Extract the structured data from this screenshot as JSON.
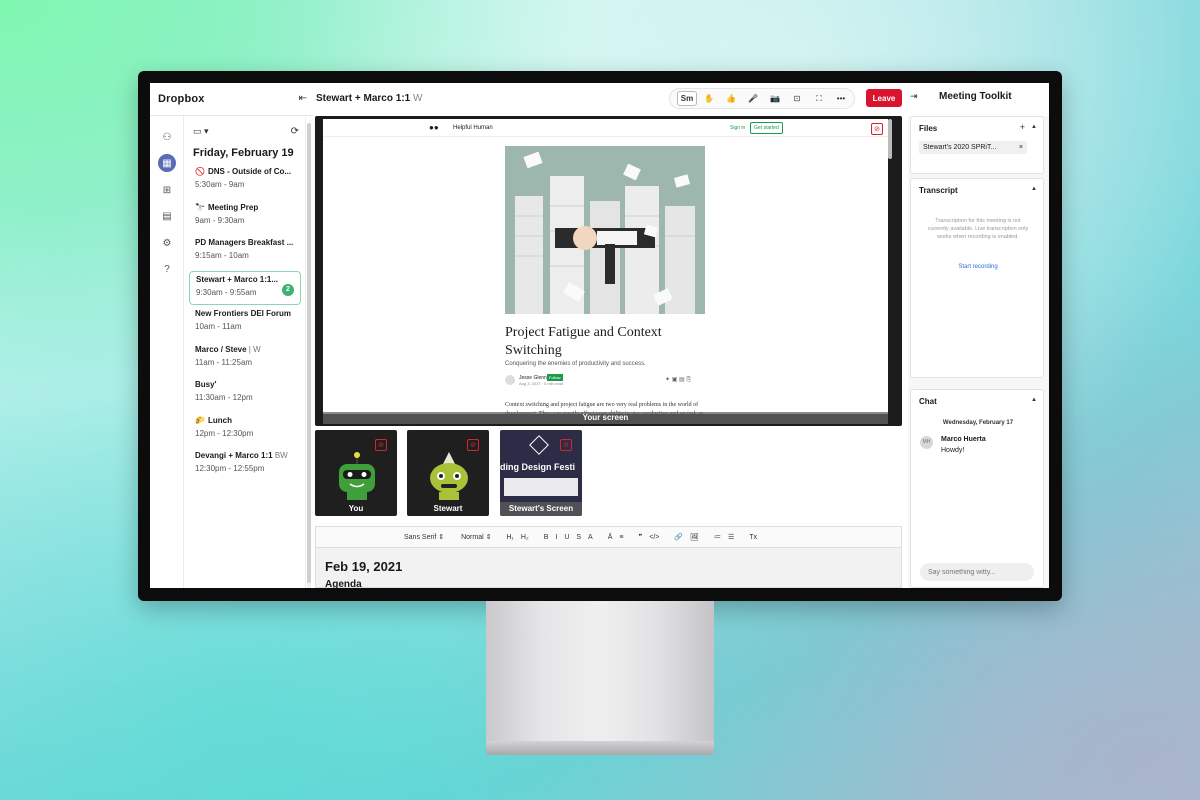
{
  "app": {
    "logo": "Dropbox",
    "collapse_icon": "collapse-left-icon"
  },
  "calendar": {
    "view_icon": "calendar-view-icon",
    "refresh_icon": "refresh-icon",
    "date_heading": "Friday, February 19",
    "events": [
      {
        "emoji": "🚫",
        "title": "DNS - Outside of Co...",
        "suffix": "",
        "time": "5:30am - 9am"
      },
      {
        "emoji": "🔭",
        "title": "Meeting Prep",
        "suffix": "",
        "time": "9am - 9:30am"
      },
      {
        "emoji": "",
        "title": "PD Managers Breakfast ...",
        "suffix": "",
        "time": "9:15am - 10am"
      },
      {
        "emoji": "",
        "title": "Stewart + Marco 1:1...",
        "suffix": "",
        "time": "9:30am - 9:55am",
        "badge": "2",
        "active": true
      },
      {
        "emoji": "",
        "title": "New Frontiers DEI Forum",
        "suffix": "",
        "time": "10am - 11am"
      },
      {
        "emoji": "",
        "title": "Marco / Steve",
        "suffix": " | W",
        "time": "11am - 11:25am"
      },
      {
        "emoji": "",
        "title": "Busy'",
        "suffix": "",
        "time": "11:30am - 12pm"
      },
      {
        "emoji": "🌮",
        "title": "Lunch",
        "suffix": "",
        "time": "12pm - 12:30pm"
      },
      {
        "emoji": "",
        "title": "Devangi + Marco 1:1",
        "suffix": " BW",
        "time": "12:30pm - 12:55pm"
      }
    ]
  },
  "meeting": {
    "title": "Stewart + Marco 1:1",
    "title_suffix": "W",
    "toolbar": [
      "Sm",
      "✋",
      "👍",
      "🎤",
      "📷",
      "⊡",
      "⛶",
      "•••"
    ],
    "leave_label": "Leave",
    "toolkit_title": "Meeting Toolkit"
  },
  "shared_screen": {
    "label": "Your screen",
    "site_name": "Helpful Human",
    "sign_in": "Sign in",
    "get_started": "Get started",
    "article_title": "Project Fatigue and Context Switching",
    "article_subtitle": "Conquering the enemies of productivity and success.",
    "author": "Jesse Glenn",
    "follow": "Follow",
    "meta": "Aug 3, 2017 · 5 min read",
    "body": "Context switching and project fatigue are two very real problems in the world of development. They can greatly affect your ability to stay productive and on task as well as the overall success of any"
  },
  "participants": [
    {
      "name": "You",
      "color": "#3f9f3a"
    },
    {
      "name": "Stewart",
      "color": "#a8c23a"
    },
    {
      "name": "Stewart's Screen",
      "color": "#2c2c46",
      "screen_text": "ding Design Festi"
    }
  ],
  "editor": {
    "toolbar": [
      "Sans Serif ⇕",
      "Normal ⇕",
      "H₁",
      "H₂",
      "B",
      "I",
      "U",
      "S",
      "A",
      "Ā",
      "≡",
      "❞",
      "</>",
      "🔗",
      "🖼",
      "≔",
      "☰",
      "Tx"
    ],
    "date": "Feb 19, 2021",
    "agenda": "Agenda"
  },
  "toolkit": {
    "files": {
      "heading": "Files",
      "items": [
        "Stewart's 2020 SPRiT..."
      ]
    },
    "transcript": {
      "heading": "Transcript",
      "note": "Transcription for this meeting is not currently available. Live transcription only works when recording is enabled.",
      "link": "Start recording"
    },
    "chat": {
      "heading": "Chat",
      "day": "Wednesday, February 17",
      "avatar": "MH",
      "sender": "Marco Huerta",
      "message": "Howdy!",
      "placeholder": "Say something witty..."
    }
  }
}
